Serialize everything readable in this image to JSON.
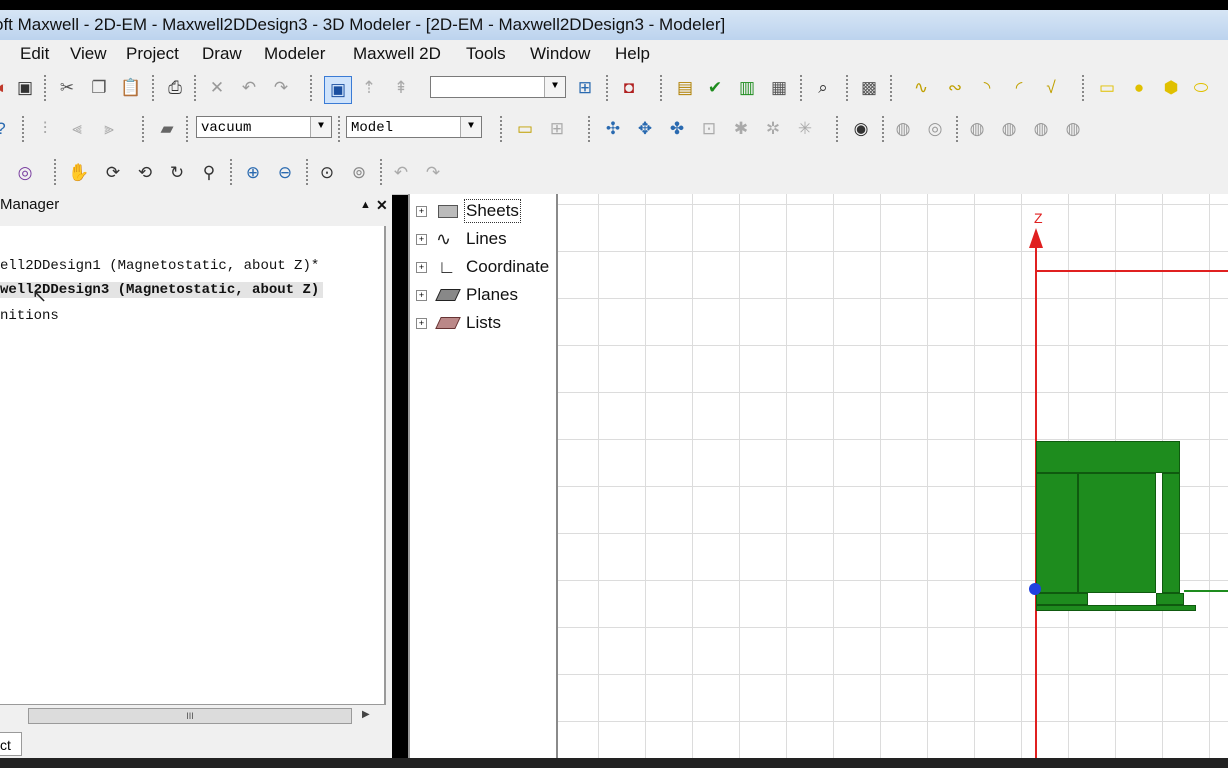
{
  "window": {
    "title": "oft Maxwell - 2D-EM - Maxwell2DDesign3 - 3D Modeler - [2D-EM - Maxwell2DDesign3 - Modeler]"
  },
  "menu": [
    "Edit",
    "View",
    "Project",
    "Draw",
    "Modeler",
    "Maxwell 2D",
    "Tools",
    "Window",
    "Help"
  ],
  "toolbar": {
    "blank_combo_value": "",
    "material_combo_value": "vacuum",
    "model_combo_value": "Model"
  },
  "project_manager": {
    "header": "Manager",
    "items": [
      "ell2DDesign1 (Magnetostatic, about Z)*",
      "well2DDesign3 (Magnetostatic, about Z)",
      "nitions"
    ],
    "scroll_grip": "III",
    "tab_label": "ct"
  },
  "model_tree": {
    "items": [
      "Sheets",
      "Lines",
      "Coordinate",
      "Planes",
      "Lists"
    ]
  },
  "viewport": {
    "axis_label": "Z",
    "colors": {
      "axis": "#e02020",
      "object": "#1e8c1e",
      "origin": "#2040e0"
    }
  }
}
